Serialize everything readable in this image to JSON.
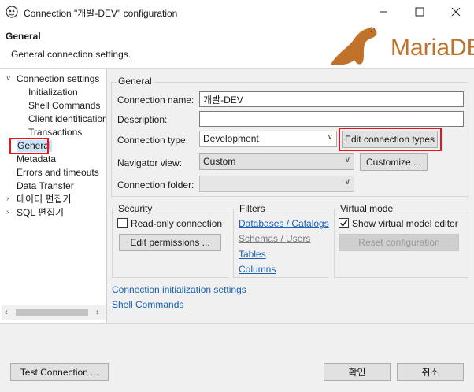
{
  "window": {
    "title": "Connection \"개발-DEV\" configuration",
    "minimize_icon": "minimize-icon",
    "maximize_icon": "maximize-icon",
    "close_icon": "close-icon"
  },
  "header": {
    "title": "General",
    "description": "General connection settings.",
    "logo_text": "MariaDB"
  },
  "sidebar": {
    "items": [
      {
        "label": "Connection settings",
        "expanded": true
      },
      {
        "label": "Initialization"
      },
      {
        "label": "Shell Commands"
      },
      {
        "label": "Client identification"
      },
      {
        "label": "Transactions"
      },
      {
        "label": "General",
        "selected": true
      },
      {
        "label": "Metadata"
      },
      {
        "label": "Errors and timeouts"
      },
      {
        "label": "Data Transfer"
      },
      {
        "label": "데이터 편집기",
        "expanded": false
      },
      {
        "label": "SQL 편집기",
        "expanded": false
      }
    ]
  },
  "general": {
    "section_title": "General",
    "connection_name_label": "Connection name:",
    "connection_name_value": "개발-DEV",
    "description_label": "Description:",
    "description_value": "",
    "connection_type_label": "Connection type:",
    "connection_type_value": "Development",
    "edit_connection_types_label": "Edit connection types",
    "navigator_view_label": "Navigator view:",
    "navigator_view_value": "Custom",
    "customize_label": "Customize ...",
    "connection_folder_label": "Connection folder:",
    "connection_folder_value": ""
  },
  "security": {
    "title": "Security",
    "readonly_label": "Read-only connection",
    "readonly_checked": false,
    "edit_permissions_label": "Edit permissions ..."
  },
  "filters": {
    "title": "Filters",
    "links": [
      "Databases / Catalogs",
      "Schemas / Users",
      "Tables",
      "Columns"
    ]
  },
  "virtual_model": {
    "title": "Virtual model",
    "show_editor_label": "Show virtual model editor",
    "show_editor_checked": true,
    "reset_label": "Reset configuration"
  },
  "links": {
    "init_settings": "Connection initialization settings",
    "shell_commands": "Shell Commands"
  },
  "footer": {
    "test_connection_label": "Test Connection ...",
    "ok_label": "확인",
    "cancel_label": "취소"
  },
  "colors": {
    "highlight_red": "#e8141b",
    "link_blue": "#1a5fb4",
    "logo_orange": "#c0722a"
  }
}
